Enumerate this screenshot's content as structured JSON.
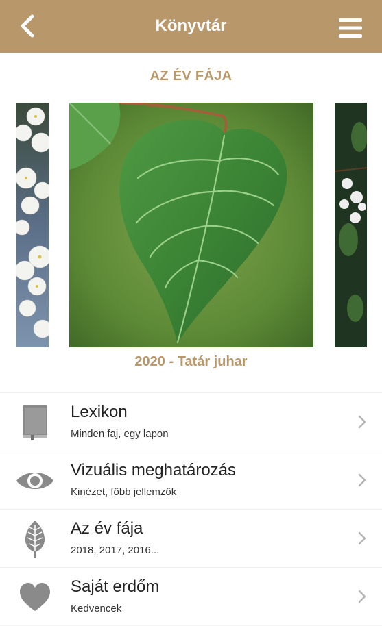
{
  "header": {
    "title": "Könyvtár",
    "back_icon": "chevron-left-icon",
    "menu_icon": "hamburger-menu-icon",
    "background_color": "#b8976a"
  },
  "tree_of_year": {
    "section_title": "AZ ÉV FÁJA",
    "caption": "2020 - Tatár juhar"
  },
  "menu": [
    {
      "label": "Lexikon",
      "subtitle": "Minden faj, egy lapon",
      "icon": "book-icon"
    },
    {
      "label": "Vizuális meghatározás",
      "subtitle": "Kinézet, főbb jellemzők",
      "icon": "eye-icon"
    },
    {
      "label": "Az év fája",
      "subtitle": "2018, 2017, 2016...",
      "icon": "leaf-icon"
    },
    {
      "label": "Saját erdőm",
      "subtitle": "Kedvencek",
      "icon": "heart-icon"
    }
  ],
  "colors": {
    "accent": "#b8976a",
    "icon_gray": "#8a8a8a",
    "divider": "#eeeeee"
  }
}
